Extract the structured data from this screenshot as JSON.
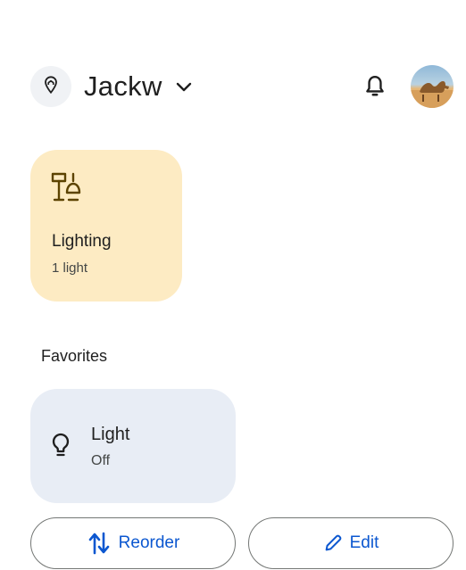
{
  "header": {
    "home_name": "Jackw"
  },
  "icons": {
    "location": "location-pin-icon",
    "dropdown": "chevron-down-icon",
    "notifications": "bell-icon",
    "avatar": "camel-avatar",
    "lighting": "lamps-icon",
    "light": "lightbulb-icon",
    "reorder": "swap-vert-icon",
    "edit": "pencil-icon"
  },
  "category_card": {
    "title": "Lighting",
    "subtitle": "1 light"
  },
  "favorites": {
    "label": "Favorites",
    "items": [
      {
        "name": "Light",
        "status": "Off"
      }
    ]
  },
  "actions": {
    "reorder_label": "Reorder",
    "edit_label": "Edit"
  },
  "colors": {
    "lighting_card_bg": "#fdebc3",
    "favorite_card_bg": "#e8edf5",
    "accent_blue": "#0b57d0",
    "lighting_icon": "#5c4300"
  }
}
